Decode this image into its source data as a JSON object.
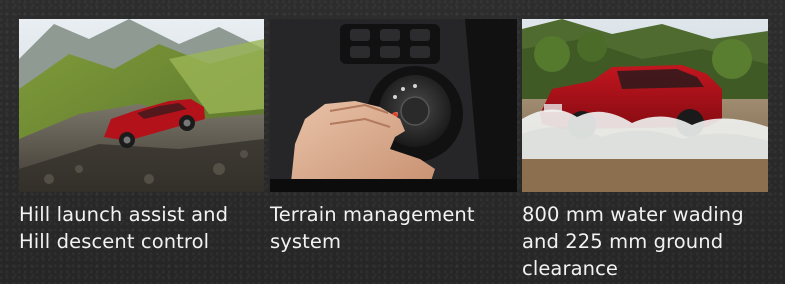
{
  "features": [
    {
      "image": "red-suv-climbing-rocky-hill-photo",
      "caption": "Hill launch assist and\nHill descent control"
    },
    {
      "image": "hand-turning-terrain-dial-photo",
      "caption": "Terrain management\nsystem"
    },
    {
      "image": "red-suv-wading-through-water-photo",
      "caption": "800 mm water wading\nand 225 mm ground\nclearance"
    }
  ],
  "colors": {
    "background": "#2a2a2a",
    "caption_text": "#f2f2f2",
    "vehicle_red": "#b3121a"
  }
}
